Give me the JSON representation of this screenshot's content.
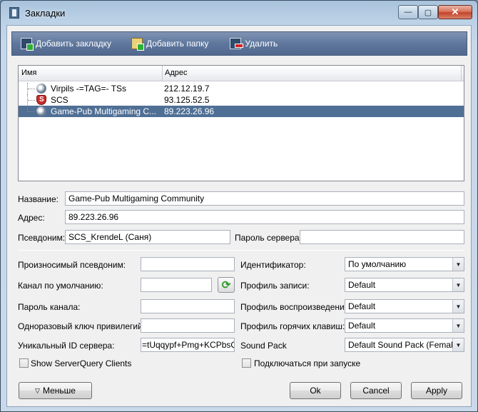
{
  "window": {
    "title": "Закладки",
    "controls": {
      "minimize": "—",
      "maximize": "▢",
      "close": "✕"
    }
  },
  "toolbar": {
    "add_bookmark": "Добавить закладку",
    "add_folder": "Добавить папку",
    "delete": "Удалить"
  },
  "tree": {
    "columns": {
      "name": "Имя",
      "address": "Адрес"
    },
    "rows": [
      {
        "name": "Virpils -=TAG=- TSs",
        "address": "212.12.19.7",
        "icon": "teamspeak-icon",
        "selected": false
      },
      {
        "name": "SCS",
        "address": "93.125.52.5",
        "icon": "shield-icon",
        "selected": false
      },
      {
        "name": "Game-Pub Multigaming C...",
        "address": "89.223.26.96",
        "icon": "teamspeak-icon",
        "selected": true
      }
    ]
  },
  "form": {
    "name_label": "Название:",
    "name_value": "Game-Pub Multigaming Community",
    "address_label": "Адрес:",
    "address_value": "89.223.26.96",
    "nickname_label": "Псевдоним:",
    "nickname_value": "SCS_KrendeL (Саня)",
    "server_password_label": "Пароль сервера:",
    "server_password_value": ""
  },
  "advanced": {
    "phonetic_label": "Произносимый псевдоним:",
    "phonetic_value": "",
    "default_channel_label": "Канал по умолчанию:",
    "default_channel_value": "",
    "channel_password_label": "Пароль канала:",
    "channel_password_value": "",
    "privilege_key_label": "Одноразовый ключ привилегий:",
    "privilege_key_value": "",
    "unique_id_label": "Уникальный ID сервера:",
    "unique_id_value": "=tUqqypf+Pmg+KCPbsQ=",
    "identity_label": "Идентификатор:",
    "identity_value": "По умолчанию",
    "capture_label": "Профиль записи:",
    "capture_value": "Default",
    "playback_label": "Профиль воспроизведения:",
    "playback_value": "Default",
    "hotkey_label": "Профиль горячих клавиш:",
    "hotkey_value": "Default",
    "soundpack_label": "Sound Pack",
    "soundpack_value": "Default Sound Pack (Female)",
    "show_serverquery_label": "Show ServerQuery Clients",
    "connect_on_startup_label": "Подключаться при запуске"
  },
  "buttons": {
    "less": "Меньше",
    "less_glyph": "▽",
    "ok": "Ok",
    "cancel": "Cancel",
    "apply": "Apply"
  },
  "colors": {
    "toolbar_bg": "#5f779d",
    "selection_bg": "#4f6f95",
    "close_button": "#c3432a"
  }
}
